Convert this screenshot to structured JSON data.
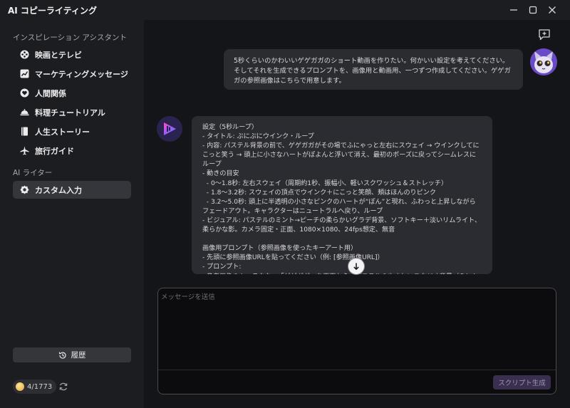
{
  "app": {
    "title": "AI コピーライティング"
  },
  "sidebar": {
    "section1": "インスピレーション アシスタント",
    "items": [
      {
        "label": "映画とテレビ",
        "icon": "film-reel-icon"
      },
      {
        "label": "マーケティングメッセージ",
        "icon": "chart-icon"
      },
      {
        "label": "人間関係",
        "icon": "heart-icon"
      },
      {
        "label": "料理チュートリアル",
        "icon": "cloche-icon"
      },
      {
        "label": "人生ストーリー",
        "icon": "book-icon"
      },
      {
        "label": "旅行ガイド",
        "icon": "airplane-icon"
      }
    ],
    "section2": "AI ライター",
    "custom": {
      "label": "カスタム入力",
      "icon": "gear-icon"
    },
    "history": "履歴",
    "credits": "4/1773"
  },
  "chat": {
    "user_message": "5秒くらいのかわいいゲゲガガのショート動画を作りたい。何かいい設定を考えてください。そしてそれを生成できるプロンプトを、画像用と動画用、一つずつ作成してください。ゲゲガガの参照画像はこちらで用意します。",
    "assistant_message": "設定（5秒ループ）\n- タイトル: ぷにぷにウインク・ループ\n- 内容: パステル背景の前で、ゲゲガガがその場でふにゃっと左右にスウェイ → ウインクしてにこっと笑う → 頭上に小さなハートがぽよんと浮いて消え、最初のポーズに戻ってシームレスにループ\n- 動きの目安\n  - 0～1.8秒: 左右スウェイ（周期約1秒、振幅小、軽いスクワッシュ＆ストレッチ）\n  - 1.8～3.2秒: スウェイの頂点でウインク＋にこっと笑顔、頬はほんのりピンク\n  - 3.2～5.0秒: 頭上に半透明の小さなピンクのハートが“ぽん”と現れ、ふわっと上昇しながらフェードアウト。キャラクターはニュートラルへ戻り、ループ\n- ビジュアル: パステルのミント→ピーチの柔らかいグラデ背景、ソフトキー＋淡いリムライト、柔らかな影。カメラ固定・正面、1080×1080、24fps想定、無音\n\n画像用プロンプト（参照画像を使ったキーアート用）\n- 先頭に参照画像URLを貼ってください（例: [参照画像URL]）\n- プロンプト:\n  参考画像のキャラクター「ゲゲガガ」を正面から、パステルのやさしいスタジオ背景（ミントからピーチへの柔らかなグラデーション）、画面中央に配置、ぷにっとした丸みともっちり質"
  },
  "composer": {
    "placeholder": "メッセージを送信",
    "generate_label": "スクリプト生成"
  },
  "colors": {
    "sidebar_bg": "#1c1d21",
    "main_bg": "#141518",
    "bubble_bg": "#2b2c31",
    "accent": "#3a2f4f"
  }
}
